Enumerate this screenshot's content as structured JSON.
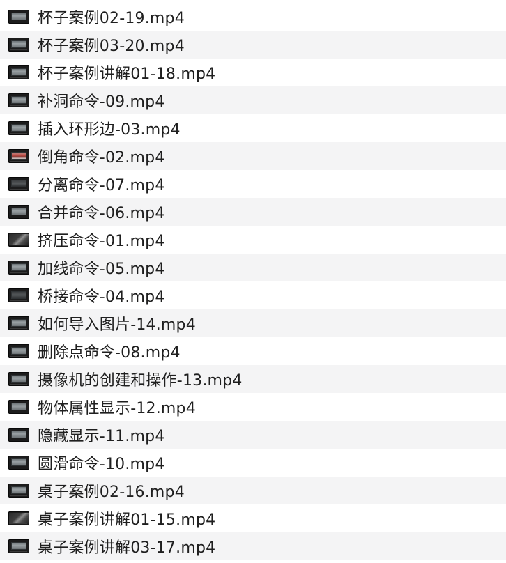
{
  "files": [
    {
      "name": "杯子案例02-19.mp4",
      "icon": "video-thumbnail-icon"
    },
    {
      "name": "杯子案例03-20.mp4",
      "icon": "video-thumbnail-icon"
    },
    {
      "name": "杯子案例讲解01-18.mp4",
      "icon": "video-thumbnail-icon"
    },
    {
      "name": "补洞命令-09.mp4",
      "icon": "video-thumbnail-icon"
    },
    {
      "name": "插入环形边-03.mp4",
      "icon": "video-thumbnail-icon"
    },
    {
      "name": "倒角命令-02.mp4",
      "icon": "video-thumbnail-icon"
    },
    {
      "name": "分离命令-07.mp4",
      "icon": "video-thumbnail-icon"
    },
    {
      "name": "合并命令-06.mp4",
      "icon": "video-thumbnail-icon"
    },
    {
      "name": "挤压命令-01.mp4",
      "icon": "video-thumbnail-icon"
    },
    {
      "name": "加线命令-05.mp4",
      "icon": "video-thumbnail-icon"
    },
    {
      "name": "桥接命令-04.mp4",
      "icon": "video-thumbnail-icon"
    },
    {
      "name": "如何导入图片-14.mp4",
      "icon": "video-thumbnail-icon"
    },
    {
      "name": "删除点命令-08.mp4",
      "icon": "video-thumbnail-icon"
    },
    {
      "name": "摄像机的创建和操作-13.mp4",
      "icon": "video-thumbnail-icon"
    },
    {
      "name": "物体属性显示-12.mp4",
      "icon": "video-thumbnail-icon"
    },
    {
      "name": "隐藏显示-11.mp4",
      "icon": "video-thumbnail-icon"
    },
    {
      "name": "圆滑命令-10.mp4",
      "icon": "video-thumbnail-icon"
    },
    {
      "name": "桌子案例02-16.mp4",
      "icon": "video-thumbnail-icon"
    },
    {
      "name": "桌子案例讲解01-15.mp4",
      "icon": "video-thumbnail-icon"
    },
    {
      "name": "桌子案例讲解03-17.mp4",
      "icon": "video-thumbnail-icon"
    }
  ]
}
